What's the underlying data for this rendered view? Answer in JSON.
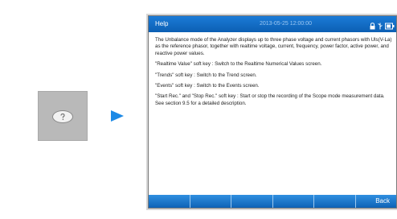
{
  "screen": {
    "title": "Help",
    "datetime": "2013-05-25 12:00:00",
    "accent_color": "#0c5fb3",
    "status_icons": [
      "lock-icon",
      "usb-icon",
      "battery-icon"
    ]
  },
  "help": {
    "paragraphs": [
      "The Unbalance mode of the Analyzer displays up to three phase voltage and current phasors with Uls(V-La) as the reference phasor, together with realtime voltage, current, frequency, power factor, active power, and reactive power values.",
      "\"Realtime Value\" soft key : Switch to the Realtime Numerical Values screen.",
      "\"Trends\" soft key : Switch to the Trend screen.",
      "\"Events\" soft key : Switch to the Events screen.",
      "\"Start Rec.\" and \"Stop Rec.\" soft key : Start or stop the recording of the Scope mode measurement data. See section 9.5 for a detailed description."
    ]
  },
  "softkeys": [
    "",
    "",
    "",
    "",
    "",
    "Back"
  ],
  "icons": {
    "help_key": "help-key-icon",
    "pointer": "arrow-right-icon"
  }
}
